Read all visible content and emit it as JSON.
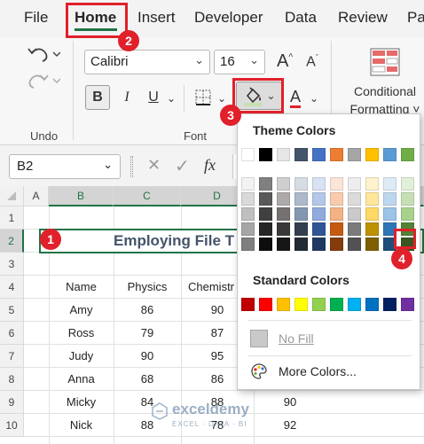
{
  "menubar": {
    "tabs": [
      "File",
      "Home",
      "Insert",
      "Developer",
      "Data",
      "Review",
      "Pa"
    ],
    "active_tab": "Home"
  },
  "ribbon": {
    "undo_group_label": "Undo",
    "font_group_label": "Font",
    "font_name": "Calibri",
    "font_size": "16",
    "bold_label": "B",
    "italic_label": "I",
    "underline_label": "U",
    "font_color_label": "A",
    "conditional_formatting_line1": "Conditional",
    "conditional_formatting_line2": "Formatting ˅"
  },
  "formula_bar": {
    "name_box": "B2",
    "fx_label": "fx",
    "cancel_glyph": "✕",
    "enter_glyph": "✓"
  },
  "sheet": {
    "columns": [
      "A",
      "B",
      "C",
      "D"
    ],
    "rows": [
      "1",
      "2",
      "3",
      "4",
      "5",
      "6",
      "7",
      "8",
      "9",
      "10"
    ],
    "title": "Employing File T",
    "headers": [
      "Name",
      "Physics",
      "Chemistr"
    ],
    "data": [
      [
        "Amy",
        "86",
        "90",
        ""
      ],
      [
        "Ross",
        "79",
        "87",
        ""
      ],
      [
        "Judy",
        "90",
        "95",
        ""
      ],
      [
        "Anna",
        "68",
        "86",
        ""
      ],
      [
        "Micky",
        "84",
        "88",
        "90"
      ],
      [
        "Nick",
        "88",
        "78",
        "92"
      ]
    ]
  },
  "fill_menu": {
    "theme_colors_label": "Theme Colors",
    "standard_colors_label": "Standard Colors",
    "no_fill_label": "No Fill",
    "more_colors_label": "More Colors...",
    "theme_top_row": [
      "#ffffff",
      "#000000",
      "#e7e6e6",
      "#44546a",
      "#4472c4",
      "#ed7d31",
      "#a5a5a5",
      "#ffc000",
      "#5b9bd5",
      "#70ad47"
    ],
    "theme_shades": [
      [
        "#f2f2f2",
        "#808080",
        "#d0cece",
        "#d6dce4",
        "#d9e2f3",
        "#fbe5d6",
        "#ededed",
        "#fff2cc",
        "#deebf7",
        "#e2f0d9"
      ],
      [
        "#d9d9d9",
        "#595959",
        "#aeaaaa",
        "#adb9ca",
        "#b4c7e7",
        "#f8cbad",
        "#dbdbdb",
        "#ffe699",
        "#bdd7ee",
        "#c5e0b4"
      ],
      [
        "#bfbfbf",
        "#404040",
        "#757171",
        "#8497b0",
        "#8faadc",
        "#f4b183",
        "#c9c9c9",
        "#ffd966",
        "#9dc3e6",
        "#a9d18e"
      ],
      [
        "#a6a6a6",
        "#262626",
        "#3a3838",
        "#333f50",
        "#2f5597",
        "#c55a11",
        "#7b7b7b",
        "#bf9000",
        "#2e75b6",
        "#548235"
      ],
      [
        "#7f7f7f",
        "#0d0d0d",
        "#171616",
        "#222a35",
        "#1f3864",
        "#843c0c",
        "#525252",
        "#7f6000",
        "#1f4e79",
        "#385723"
      ]
    ],
    "standard": [
      "#c00000",
      "#ff0000",
      "#ffc000",
      "#ffff00",
      "#92d050",
      "#00b050",
      "#00b0f0",
      "#0070c0",
      "#002060",
      "#7030a0"
    ]
  },
  "annotations": [
    "1",
    "2",
    "3",
    "4"
  ],
  "watermark": {
    "brand": "exceldemy",
    "tagline": "EXCEL · DATA · BI"
  },
  "colors": {
    "excel_green": "#217346",
    "annotation_red": "#e0202a",
    "title_text": "#44546a"
  }
}
